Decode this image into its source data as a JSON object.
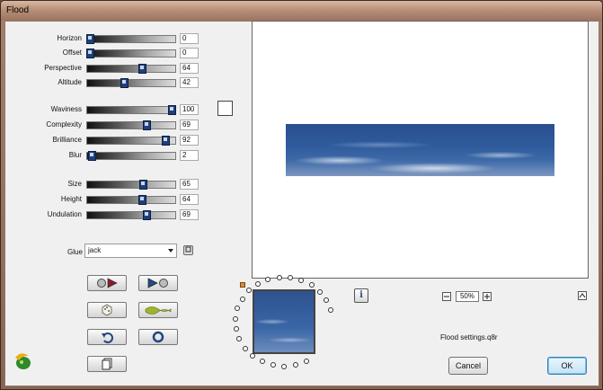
{
  "window": {
    "title": "Flood"
  },
  "sliders_group1": [
    {
      "label": "Horizon",
      "value": "0",
      "fraction": 0.0
    },
    {
      "label": "Offset",
      "value": "0",
      "fraction": 0.0
    },
    {
      "label": "Perspective",
      "value": "64",
      "fraction": 0.64
    },
    {
      "label": "Altitude",
      "value": "42",
      "fraction": 0.42
    }
  ],
  "sliders_group2": [
    {
      "label": "Waviness",
      "value": "100",
      "fraction": 1.0
    },
    {
      "label": "Complexity",
      "value": "69",
      "fraction": 0.69
    },
    {
      "label": "Brilliance",
      "value": "92",
      "fraction": 0.92
    },
    {
      "label": "Blur",
      "value": "2",
      "fraction": 0.02
    }
  ],
  "sliders_group3": [
    {
      "label": "Size",
      "value": "65",
      "fraction": 0.65
    },
    {
      "label": "Height",
      "value": "64",
      "fraction": 0.64
    },
    {
      "label": "Undulation",
      "value": "69",
      "fraction": 0.69
    }
  ],
  "glue": {
    "label": "Glue",
    "value": "jack"
  },
  "preview": {
    "zoom": "50%"
  },
  "footer": {
    "settings_name": "Flood settings.q8r",
    "cancel_label": "Cancel",
    "ok_label": "OK"
  },
  "colors": {
    "water_dark": "#2a4f8e",
    "water_light": "#7d97c0",
    "accent": "#1e3f7a"
  },
  "icons": {
    "toolbar": [
      "load-settings-icon",
      "save-settings-icon",
      "random-dice-icon",
      "wave-icon",
      "undo-icon",
      "reset-icon",
      "copy-icon"
    ]
  }
}
